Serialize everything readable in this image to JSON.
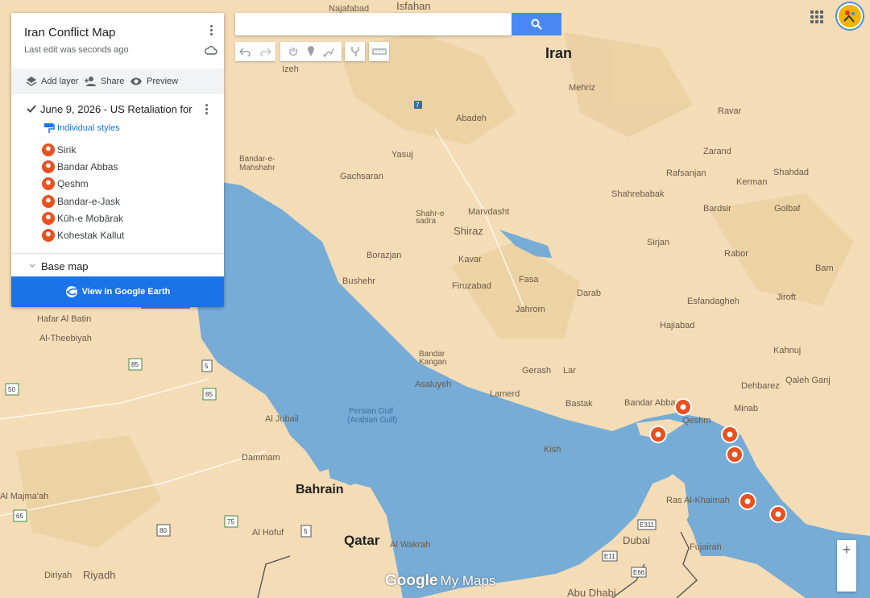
{
  "map_title": "Iran Conflict Map",
  "last_edit": "Last edit was seconds ago",
  "toolbar": {
    "add_layer": "Add layer",
    "share": "Share",
    "preview": "Preview"
  },
  "layer": {
    "title": "June 9, 2026 - US Retaliation for ...",
    "styles": "Individual styles",
    "places": [
      "Sirik",
      "Bandar Abbas",
      "Qeshm",
      "Bandar-e-Jask",
      "Kūh-e Mobārak",
      "Kohestak Kallut"
    ]
  },
  "base_map": "Base map",
  "earth_button": "View in Google Earth",
  "search": {
    "value": "",
    "placeholder": ""
  },
  "logo": {
    "google": "Google",
    "mymaps": "My Maps"
  },
  "zoom_in": "+",
  "colors": {
    "land": "#f3dcb6",
    "water": "#76acd6",
    "pin": "#e8501f",
    "accent": "#1a73e8"
  },
  "map": {
    "countries": [
      "Iran",
      "Bahrain",
      "Qatar"
    ],
    "water_labels": [
      "Persian Gulf",
      "(Arabian Gulf)"
    ],
    "places": [
      "Najafabad",
      "Isfahan",
      "Izeh",
      "Mehriz",
      "Ravar",
      "Abadeh",
      "Zarand",
      "Yasuj",
      "Rafsanjan",
      "Kerman",
      "Shahdad",
      "Bandar-e-Mahshahr",
      "Gachsaran",
      "Shahrebabak",
      "Bardsir",
      "Golbaf",
      "Shahr-e-sadra",
      "Marvdasht",
      "Shiraz",
      "Sirjan",
      "Rabor",
      "Borazjan",
      "Kavar",
      "Fasa",
      "Bam",
      "Bushehr",
      "Firuzabad",
      "Darab",
      "Jiroft",
      "Hafar Al Batin",
      "Jahrom",
      "Esfandagheh",
      "Al-Theebiyah",
      "Hajiabad",
      "Kahnuj",
      "Bandar Kangan",
      "Gerash",
      "Lar",
      "Qaleh Ganj",
      "Asaluyeh",
      "Lamerd",
      "Dehbarez",
      "Bastak",
      "Bandar Abbas",
      "Minab",
      "Al Jubail",
      "Qeshm",
      "Kish",
      "Dammam",
      "Ras Al-Khaimah",
      "Al Majma'ah",
      "Al Hofuf",
      "Al Wakrah",
      "Dubai",
      "Fujairah",
      "Riyadh",
      "Diriyah",
      "Abu Dhabi"
    ],
    "road_shields": [
      "7",
      "85",
      "5",
      "50",
      "85",
      "65",
      "75",
      "80",
      "5",
      "E311",
      "E11",
      "E66"
    ]
  }
}
